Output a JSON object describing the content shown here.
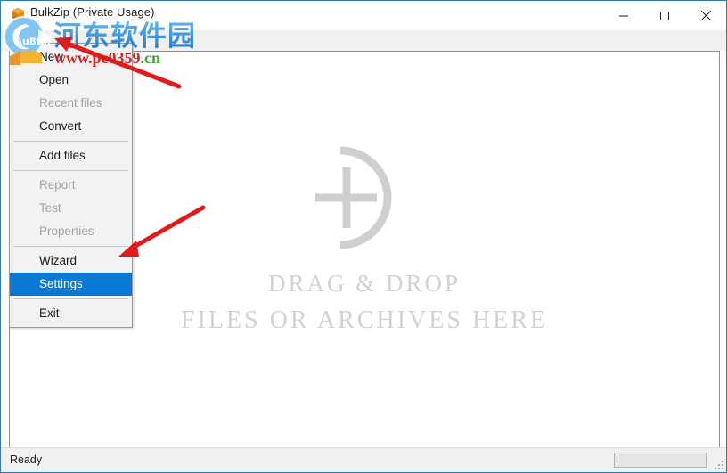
{
  "window": {
    "title": "BulkZip (Private Usage)",
    "icon": "box-icon",
    "accent_color": "#0a79d6",
    "titlebar_bg": "#ffffff",
    "toolbar_bg": "#f0f0f0",
    "border_color": "#2d7cb8"
  },
  "caption_buttons": [
    {
      "name": "minimize",
      "label": "─",
      "glyph": "minimize-icon"
    },
    {
      "name": "maximize",
      "label": "☐",
      "glyph": "maximize-icon"
    },
    {
      "name": "close",
      "label": "✕",
      "glyph": "close-icon"
    }
  ],
  "menu": {
    "items": [
      {
        "label": "New",
        "enabled": true,
        "selected": false,
        "type": "item"
      },
      {
        "label": "Open",
        "enabled": true,
        "selected": false,
        "type": "item"
      },
      {
        "label": "Recent files",
        "enabled": false,
        "selected": false,
        "type": "item"
      },
      {
        "label": "Convert",
        "enabled": true,
        "selected": false,
        "type": "item"
      },
      {
        "type": "separator"
      },
      {
        "label": "Add files",
        "enabled": true,
        "selected": false,
        "type": "item"
      },
      {
        "type": "separator"
      },
      {
        "label": "Report",
        "enabled": false,
        "selected": false,
        "type": "item"
      },
      {
        "label": "Test",
        "enabled": false,
        "selected": false,
        "type": "item"
      },
      {
        "label": "Properties",
        "enabled": false,
        "selected": false,
        "type": "item"
      },
      {
        "type": "separator"
      },
      {
        "label": "Wizard",
        "enabled": true,
        "selected": false,
        "type": "item"
      },
      {
        "label": "Settings",
        "enabled": true,
        "selected": true,
        "type": "item"
      },
      {
        "type": "separator"
      },
      {
        "label": "Exit",
        "enabled": true,
        "selected": false,
        "type": "item"
      }
    ]
  },
  "dropzone": {
    "graphic": "plus-in-arc-icon",
    "line1": "DRAG & DROP",
    "line2": "FILES OR ARCHIVES HERE",
    "text_color": "#d2d2d6"
  },
  "statusbar": {
    "status_text": "Ready",
    "progress_value": 0
  },
  "watermark": {
    "site_name": "河东软件园",
    "url_main": "www.pc0359",
    "url_tld": ".cn",
    "url_main_color": "#d42020",
    "url_tld_color": "#3ba82f",
    "logo": "site-logo-icon"
  },
  "annotations": {
    "arrow_color": "#e01b1b",
    "arrow_1_target": "New",
    "arrow_2_target": "Settings"
  }
}
